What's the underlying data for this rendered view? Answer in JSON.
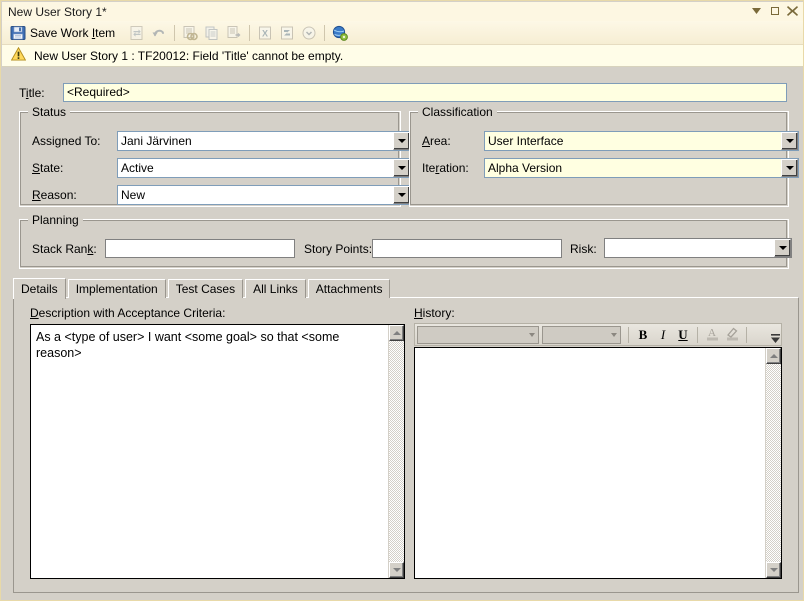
{
  "window": {
    "title": "New User Story 1*",
    "controls": {
      "menu_caret": "▼",
      "restore": "restore-square",
      "close": "✕"
    }
  },
  "toolbar": {
    "save_label_pre": "Save Work ",
    "save_label_accel": "I",
    "save_label_post": "tem",
    "save_label_full": "Save Work Item",
    "items": [
      {
        "name": "save-work-item-button",
        "label": "Save Work Item",
        "enabled": true
      },
      {
        "name": "refresh-button",
        "label": "Refresh",
        "enabled": false
      },
      {
        "name": "undo-button",
        "label": "Undo",
        "enabled": false
      },
      {
        "name": "link-to-button",
        "label": "Link To",
        "enabled": false
      },
      {
        "name": "copy-button",
        "label": "Copy",
        "enabled": false
      },
      {
        "name": "copy-to-clipboard-button",
        "label": "Copy To Clipboard",
        "enabled": false
      },
      {
        "name": "open-in-excel-button",
        "label": "Open in Microsoft Excel",
        "enabled": false
      },
      {
        "name": "open-in-project-button",
        "label": "Open in Microsoft Project",
        "enabled": false
      },
      {
        "name": "history-button",
        "label": "History",
        "enabled": false
      },
      {
        "name": "help-button",
        "label": "Help",
        "enabled": true
      }
    ]
  },
  "warning": {
    "icon": "warning-triangle-icon",
    "message": "New User Story 1 : TF20012: Field 'Title' cannot be empty."
  },
  "fields": {
    "title": {
      "label_pre": "T",
      "label_accel": "i",
      "label_post": "tle:",
      "label": "Title:",
      "value": "<Required>",
      "required": true
    }
  },
  "status_group": {
    "legend": "Status",
    "assigned_to": {
      "label_pre": "Assi",
      "label_accel": "g",
      "label_post": "ned To:",
      "label": "Assigned To:",
      "value": "Jani Järvinen"
    },
    "state": {
      "label_pre": "",
      "label_accel": "S",
      "label_post": "tate:",
      "label": "State:",
      "value": "Active"
    },
    "reason": {
      "label_pre": "",
      "label_accel": "R",
      "label_post": "eason:",
      "label": "Reason:",
      "value": "New"
    }
  },
  "classification_group": {
    "legend": "Classification",
    "area": {
      "label_pre": "",
      "label_accel": "A",
      "label_post": "rea:",
      "label": "Area:",
      "value": "User Interface"
    },
    "iteration": {
      "label_pre": "Ite",
      "label_accel": "r",
      "label_post": "ation:",
      "label": "Iteration:",
      "value": "Alpha Version"
    }
  },
  "planning_group": {
    "legend": "Planning",
    "stack_rank": {
      "label_pre": "Stack Ran",
      "label_accel": "k",
      "label_post": ":",
      "label": "Stack Rank:",
      "value": ""
    },
    "story_points": {
      "label_pre": "Story Points",
      "label_accel": "",
      "label_post": ":",
      "label": "Story Points:",
      "value": ""
    },
    "risk": {
      "label_pre": "Risk",
      "label_accel": "",
      "label_post": ":",
      "label": "Risk:",
      "value": ""
    }
  },
  "tabs": [
    {
      "label": "Details",
      "active": true
    },
    {
      "label": "Implementation",
      "active": false
    },
    {
      "label": "Test Cases",
      "active": false
    },
    {
      "label": "All Links",
      "active": false
    },
    {
      "label": "Attachments",
      "active": false
    }
  ],
  "details_tab": {
    "description": {
      "label_pre": "",
      "label_accel": "D",
      "label_post": "escription with Acceptance Criteria:",
      "label": "Description with Acceptance Criteria:",
      "value": "As a <type of user> I want <some goal> so that <some reason>"
    },
    "history": {
      "label_pre": "",
      "label_accel": "H",
      "label_post": "istory:",
      "label": "History:",
      "value": "",
      "toolbar": {
        "font_family_value": "",
        "font_size_value": "",
        "bold_label": "B",
        "italic_label": "I",
        "underline_label": "U",
        "font_color_label": "A",
        "highlight_label": "highlight",
        "overflow_label": "⯆"
      }
    }
  },
  "colors": {
    "window_chrome": "#d4d0c8",
    "titlebar_bg": "#fdf7e2",
    "titlebar_border": "#e8d9a8",
    "toolbar_bg": "#fdf8e6",
    "warning_bg": "#fffde8",
    "required_field_bg": "#ffffe1",
    "input_border": "#7f9db9",
    "title_button_fg": "#7a6a3a"
  }
}
